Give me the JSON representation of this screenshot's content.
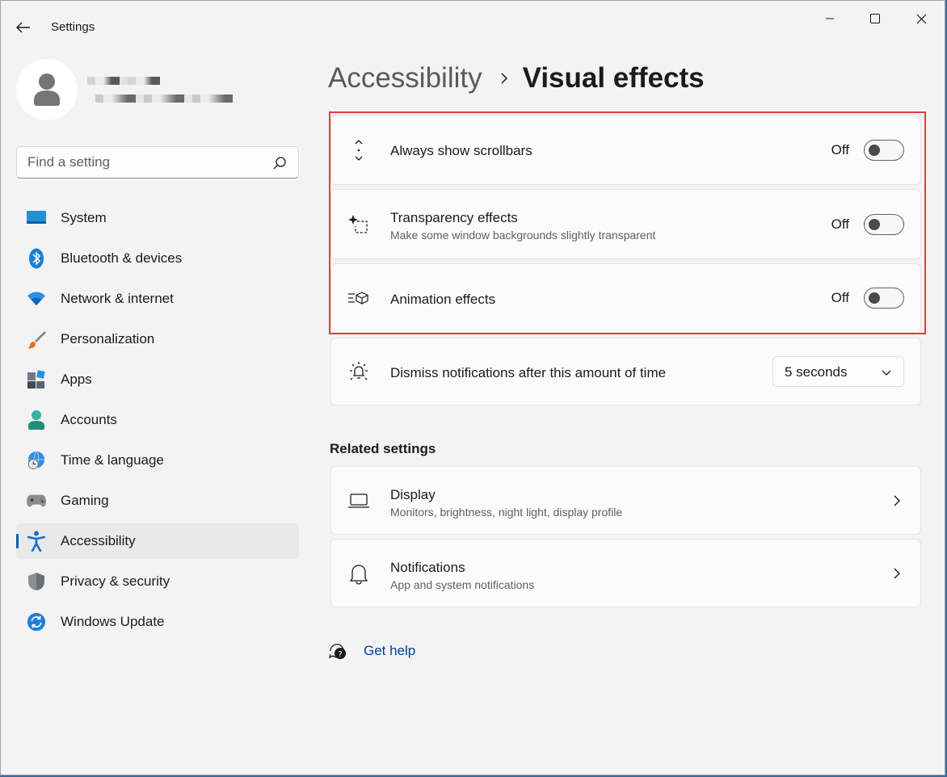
{
  "window": {
    "title": "Settings",
    "back_icon": "arrow-left-icon",
    "controls": [
      "minimize-icon",
      "maximize-icon",
      "close-icon"
    ]
  },
  "search": {
    "placeholder": "Find a setting",
    "icon": "search-icon"
  },
  "sidebar": {
    "items": [
      {
        "label": "System",
        "icon": "system-monitor-icon",
        "active": false
      },
      {
        "label": "Bluetooth & devices",
        "icon": "bluetooth-icon",
        "active": false
      },
      {
        "label": "Network & internet",
        "icon": "wifi-icon",
        "active": false
      },
      {
        "label": "Personalization",
        "icon": "paintbrush-icon",
        "active": false
      },
      {
        "label": "Apps",
        "icon": "apps-icon",
        "active": false
      },
      {
        "label": "Accounts",
        "icon": "account-icon",
        "active": false
      },
      {
        "label": "Time & language",
        "icon": "globe-clock-icon",
        "active": false
      },
      {
        "label": "Gaming",
        "icon": "gamepad-icon",
        "active": false
      },
      {
        "label": "Accessibility",
        "icon": "accessibility-icon",
        "active": true
      },
      {
        "label": "Privacy & security",
        "icon": "shield-icon",
        "active": false
      },
      {
        "label": "Windows Update",
        "icon": "update-icon",
        "active": false
      }
    ]
  },
  "breadcrumb": {
    "parent": "Accessibility",
    "separator_icon": "chevron-right-icon",
    "current": "Visual effects"
  },
  "settings": {
    "scrollbars": {
      "title": "Always show scrollbars",
      "state": "Off",
      "icon": "scrollbar-arrows-icon"
    },
    "transparency": {
      "title": "Transparency effects",
      "subtitle": "Make some window backgrounds slightly transparent",
      "state": "Off",
      "icon": "transparency-sparkle-icon"
    },
    "animation": {
      "title": "Animation effects",
      "state": "Off",
      "icon": "animation-icon"
    },
    "notifications_time": {
      "title": "Dismiss notifications after this amount of time",
      "value": "5 seconds",
      "icon": "brightness-bell-icon"
    }
  },
  "related": {
    "heading": "Related settings",
    "display": {
      "title": "Display",
      "subtitle": "Monitors, brightness, night light, display profile",
      "icon": "laptop-icon"
    },
    "notifications": {
      "title": "Notifications",
      "subtitle": "App and system notifications",
      "icon": "bell-icon"
    }
  },
  "help": {
    "label": "Get help",
    "icon": "help-chat-icon"
  },
  "colors": {
    "accent": "#005fb8",
    "highlight_border": "#e0403a",
    "link": "#003e92"
  }
}
